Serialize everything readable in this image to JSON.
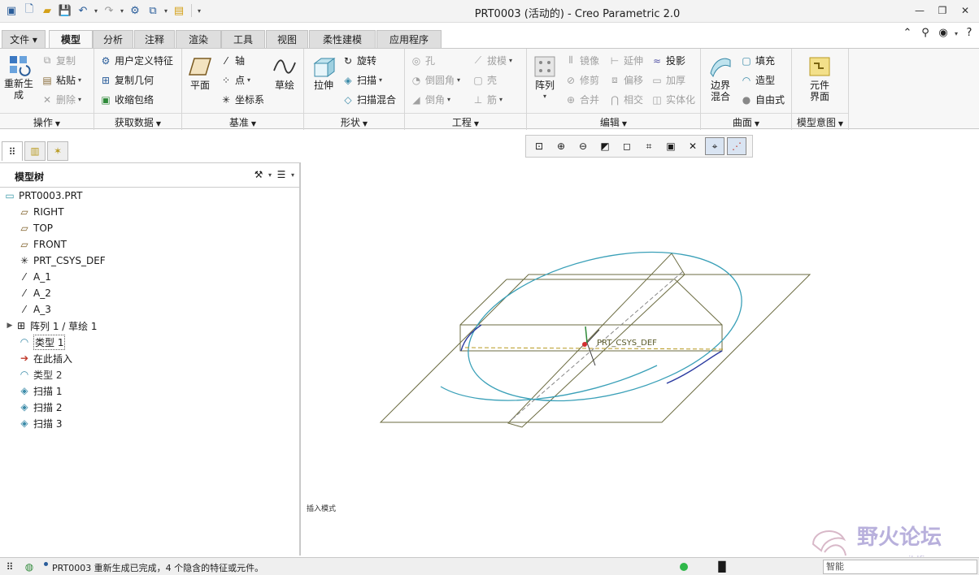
{
  "window": {
    "title": "PRT0003 (活动的) - Creo Parametric 2.0"
  },
  "menu_tabs": [
    "文件",
    "模型",
    "分析",
    "注释",
    "渲染",
    "工具",
    "视图",
    "柔性建模",
    "应用程序"
  ],
  "active_tab": "模型",
  "ribbon": {
    "operations": {
      "label": "操作",
      "regenerate": "重新生成",
      "copy": "复制",
      "paste": "粘贴",
      "delete": "删除"
    },
    "get_data": {
      "label": "获取数据",
      "user_defined_feature": "用户定义特征",
      "copy_geometry": "复制几何",
      "shrinkwrap": "收缩包络"
    },
    "datum": {
      "label": "基准",
      "plane": "平面",
      "axis": "轴",
      "point": "点",
      "csys": "坐标系",
      "sketch": "草绘"
    },
    "shapes": {
      "label": "形状",
      "extrude": "拉伸",
      "revolve": "旋转",
      "sweep": "扫描",
      "swept_blend": "扫描混合"
    },
    "engineering": {
      "label": "工程",
      "hole": "孔",
      "round": "倒圆角",
      "chamfer": "倒角",
      "draft": "拔模",
      "shell": "壳",
      "rib": "筋"
    },
    "editing": {
      "label": "编辑",
      "pattern": "阵列",
      "mirror": "镜像",
      "trim": "修剪",
      "merge": "合并",
      "extend": "延伸",
      "offset": "偏移",
      "intersect": "相交",
      "project": "投影",
      "thicken": "加厚",
      "solidify": "实体化"
    },
    "surfaces": {
      "label": "曲面",
      "boundary_blend": "边界混合",
      "fill": "填充",
      "style": "造型",
      "freestyle": "自由式"
    },
    "model_intent": {
      "label": "模型意图",
      "component_interface": "元件界面"
    }
  },
  "model_tree": {
    "title": "模型树",
    "items": [
      {
        "label": "PRT0003.PRT",
        "icon": "part-icon"
      },
      {
        "label": "RIGHT",
        "icon": "datum-plane-icon"
      },
      {
        "label": "TOP",
        "icon": "datum-plane-icon"
      },
      {
        "label": "FRONT",
        "icon": "datum-plane-icon"
      },
      {
        "label": "PRT_CSYS_DEF",
        "icon": "csys-icon"
      },
      {
        "label": "A_1",
        "icon": "axis-icon"
      },
      {
        "label": "A_2",
        "icon": "axis-icon"
      },
      {
        "label": "A_3",
        "icon": "axis-icon"
      },
      {
        "label": "阵列 1 / 草绘 1",
        "icon": "pattern-icon"
      },
      {
        "label": "类型 1",
        "icon": "style-icon"
      },
      {
        "label": "在此插入",
        "icon": "insert-arrow-icon"
      },
      {
        "label": "类型 2",
        "icon": "style-icon"
      },
      {
        "label": "扫描 1",
        "icon": "sweep-icon"
      },
      {
        "label": "扫描 2",
        "icon": "sweep-icon"
      },
      {
        "label": "扫描 3",
        "icon": "sweep-icon"
      }
    ]
  },
  "graphics": {
    "csys_label": "PRT_CSYS_DEF",
    "mode_text": "插入模式"
  },
  "watermark": {
    "text": "野火论坛",
    "url": "www.proewildfire.cn"
  },
  "status": {
    "message": "PRT0003 重新生成已完成，4 个隐含的特征或元件。",
    "filter": "智能"
  },
  "colors": {
    "accent": "#2a5d9a",
    "curve": "#3aa0b8",
    "datum": "#6b6b40"
  }
}
